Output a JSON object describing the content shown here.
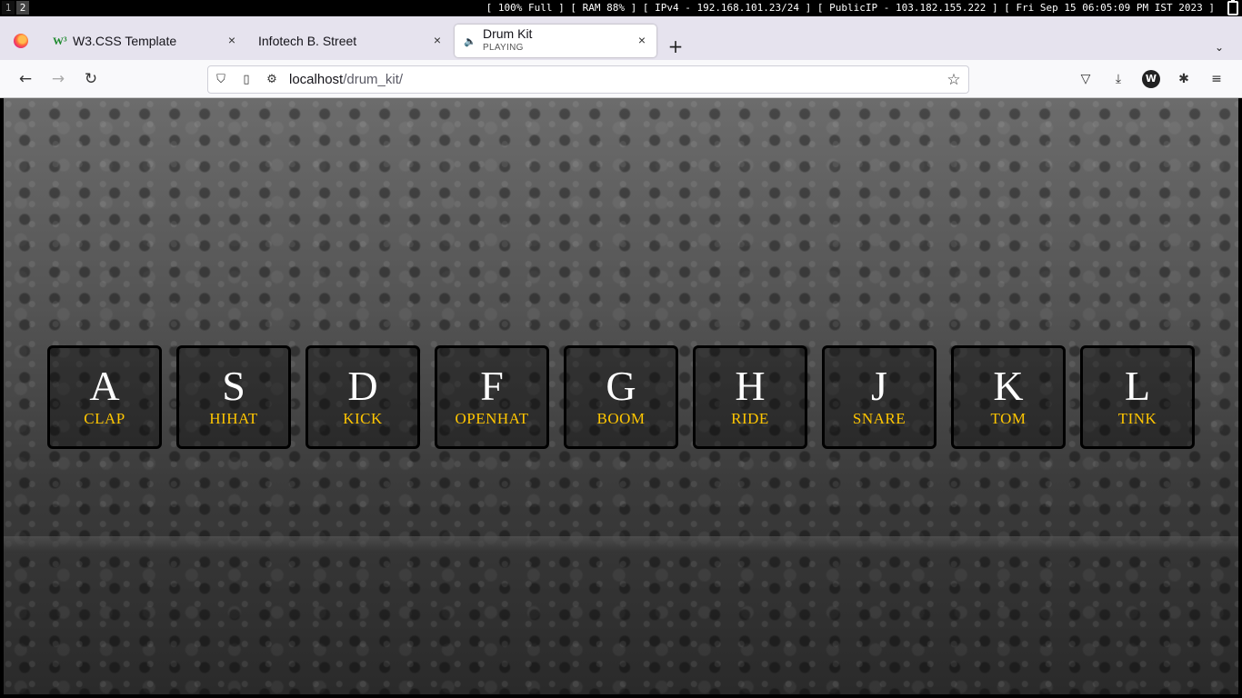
{
  "system_bar": {
    "workspaces": [
      "1",
      "2"
    ],
    "status": "[ 100% Full ] [ RAM 88% ] [ IPv4 - 192.168.101.23/24 ] [ PublicIP - 103.182.155.222 ] [ Fri Sep 15 06:05:09 PM IST 2023 ]"
  },
  "browser": {
    "tabs": [
      {
        "title": "W3.CSS Template",
        "favicon": "w3-logo-icon",
        "close": "×"
      },
      {
        "title": "Infotech B. Street",
        "close": "×"
      },
      {
        "title": "Drum Kit",
        "subtitle": "PLAYING",
        "active": true,
        "close": "×"
      }
    ],
    "new_tab": "+",
    "url": {
      "host": "localhost",
      "path": "/drum_kit/"
    },
    "icons": {
      "back": "←",
      "forward": "→",
      "reload": "↻",
      "shield": "⛉",
      "page": "▯",
      "permissions": "⚙",
      "star": "☆",
      "pocket": "▽",
      "download": "⤓",
      "account": "W",
      "extensions": "✱",
      "menu": "≡",
      "tab_list": "⌄",
      "speaker": "🔈"
    }
  },
  "drum_kit": {
    "keys": [
      {
        "key": "A",
        "sound": "CLAP"
      },
      {
        "key": "S",
        "sound": "HIHAT"
      },
      {
        "key": "D",
        "sound": "KICK"
      },
      {
        "key": "F",
        "sound": "OPENHAT"
      },
      {
        "key": "G",
        "sound": "BOOM"
      },
      {
        "key": "H",
        "sound": "RIDE"
      },
      {
        "key": "J",
        "sound": "SNARE"
      },
      {
        "key": "K",
        "sound": "TOM"
      },
      {
        "key": "L",
        "sound": "TINK"
      }
    ],
    "colors": {
      "letter": "#ffffff",
      "sound": "#ffc600",
      "border": "#000000"
    }
  }
}
